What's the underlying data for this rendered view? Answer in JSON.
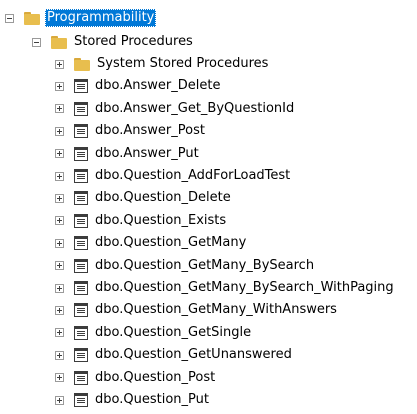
{
  "tree": {
    "root": {
      "label": "Programmability",
      "expanded": true,
      "selected": true
    },
    "stored_procedures": {
      "label": "Stored Procedures",
      "expanded": true
    },
    "items": [
      {
        "label": "System Stored Procedures",
        "type": "folder"
      },
      {
        "label": "dbo.Answer_Delete",
        "type": "procedure"
      },
      {
        "label": "dbo.Answer_Get_ByQuestionId",
        "type": "procedure"
      },
      {
        "label": "dbo.Answer_Post",
        "type": "procedure"
      },
      {
        "label": "dbo.Answer_Put",
        "type": "procedure"
      },
      {
        "label": "dbo.Question_AddForLoadTest",
        "type": "procedure"
      },
      {
        "label": "dbo.Question_Delete",
        "type": "procedure"
      },
      {
        "label": "dbo.Question_Exists",
        "type": "procedure"
      },
      {
        "label": "dbo.Question_GetMany",
        "type": "procedure"
      },
      {
        "label": "dbo.Question_GetMany_BySearch",
        "type": "procedure"
      },
      {
        "label": "dbo.Question_GetMany_BySearch_WithPaging",
        "type": "procedure"
      },
      {
        "label": "dbo.Question_GetMany_WithAnswers",
        "type": "procedure"
      },
      {
        "label": "dbo.Question_GetSingle",
        "type": "procedure"
      },
      {
        "label": "dbo.Question_GetUnanswered",
        "type": "procedure"
      },
      {
        "label": "dbo.Question_Post",
        "type": "procedure"
      },
      {
        "label": "dbo.Question_Put",
        "type": "procedure"
      }
    ],
    "colors": {
      "selection": "#0078d7",
      "folder": "#e8be4e",
      "folder_tab": "#d9a93b"
    },
    "icons": {
      "expanded": "minus-box-icon",
      "collapsed": "plus-box-icon",
      "folder": "folder-icon",
      "procedure": "stored-procedure-icon"
    }
  }
}
